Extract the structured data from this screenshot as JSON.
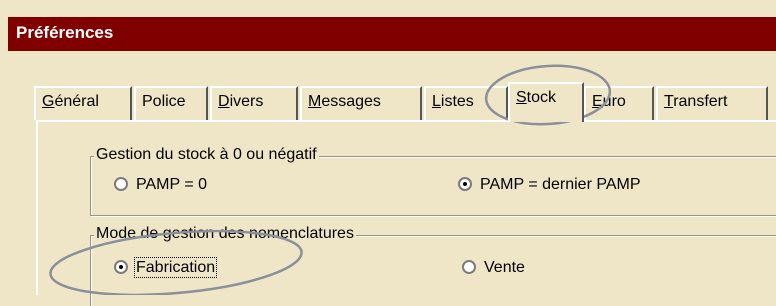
{
  "window": {
    "title": "Préférences"
  },
  "tabs": [
    {
      "label": "Général",
      "accel": "G",
      "rest": "énéral"
    },
    {
      "label": "Police",
      "accel": "",
      "rest": "Police"
    },
    {
      "label": "Divers",
      "accel": "D",
      "rest": "ivers"
    },
    {
      "label": "Messages",
      "accel": "M",
      "rest": "essages"
    },
    {
      "label": "Listes",
      "accel": "L",
      "rest": "istes"
    },
    {
      "label": "Stock",
      "accel": "S",
      "rest": "tock",
      "active": true
    },
    {
      "label": "Euro",
      "accel": "E",
      "rest": "uro"
    },
    {
      "label": "Transfert",
      "accel": "T",
      "rest": "ransfert"
    }
  ],
  "stock_group": {
    "legend": "Gestion du stock à 0 ou négatif",
    "options": [
      {
        "label": "PAMP = 0",
        "checked": false
      },
      {
        "label": "PAMP = dernier PAMP",
        "checked": true
      }
    ]
  },
  "nomenclature_group": {
    "legend": "Mode de gestion des nomenclatures",
    "options": [
      {
        "label": "Fabrication",
        "checked": true
      },
      {
        "label": "Vente",
        "checked": false
      }
    ]
  },
  "colors": {
    "titlebar": "#800000",
    "background": "#efe6c8",
    "annotation": "#8a8f9a"
  }
}
